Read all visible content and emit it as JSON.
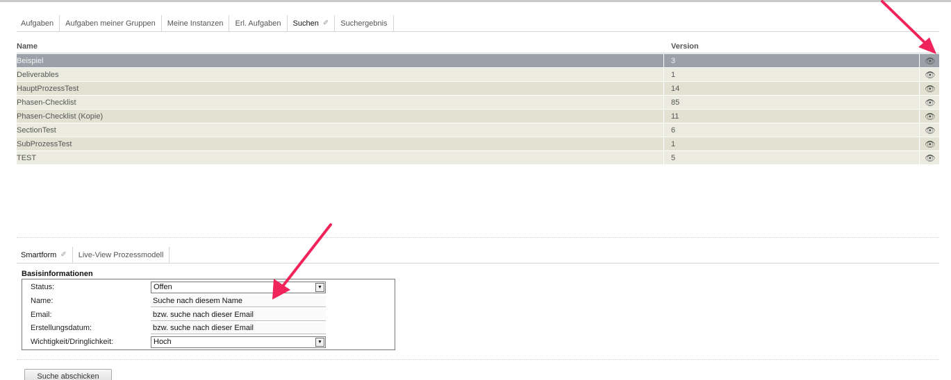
{
  "top_tabs": [
    {
      "label": "Aufgaben"
    },
    {
      "label": "Aufgaben meiner Gruppen"
    },
    {
      "label": "Meine Instanzen"
    },
    {
      "label": "Erl. Aufgaben"
    },
    {
      "label": "Suchen",
      "active": true
    },
    {
      "label": "Suchergebnis"
    }
  ],
  "results": {
    "headers": {
      "name": "Name",
      "version": "Version"
    },
    "rows": [
      {
        "name": "Beispiel",
        "version": "3",
        "selected": true
      },
      {
        "name": "Deliverables",
        "version": "1"
      },
      {
        "name": "HauptProzessTest",
        "version": "14"
      },
      {
        "name": "Phasen-Checklist",
        "version": "85"
      },
      {
        "name": "Phasen-Checklist (Kopie)",
        "version": "11"
      },
      {
        "name": "SectionTest",
        "version": "6"
      },
      {
        "name": "SubProzessTest",
        "version": "1"
      },
      {
        "name": "TEST",
        "version": "5"
      }
    ],
    "row_action_icon": "binoculars-icon"
  },
  "bottom_tabs": [
    {
      "label": "Smartform",
      "active": true
    },
    {
      "label": "Live-View Prozessmodell"
    }
  ],
  "form": {
    "section_title": "Basisinformationen",
    "fields": [
      {
        "label": "Status:",
        "type": "select",
        "value": "Offen"
      },
      {
        "label": "Name:",
        "type": "text",
        "value": "Suche nach diesem Name"
      },
      {
        "label": "Email:",
        "type": "text",
        "value": "bzw. suche nach dieser Email"
      },
      {
        "label": "Erstellungsdatum:",
        "type": "text",
        "value": "bzw. suche nach dieser Email"
      },
      {
        "label": "Wichtigkeit/Dringlichkeit:",
        "type": "select",
        "value": "Hoch"
      }
    ]
  },
  "submit_label": "Suche abschicken",
  "colors": {
    "annotation_arrow": "#f0245a",
    "selected_row": "#9aa1a8",
    "row_bg": "#e2e2d2"
  }
}
